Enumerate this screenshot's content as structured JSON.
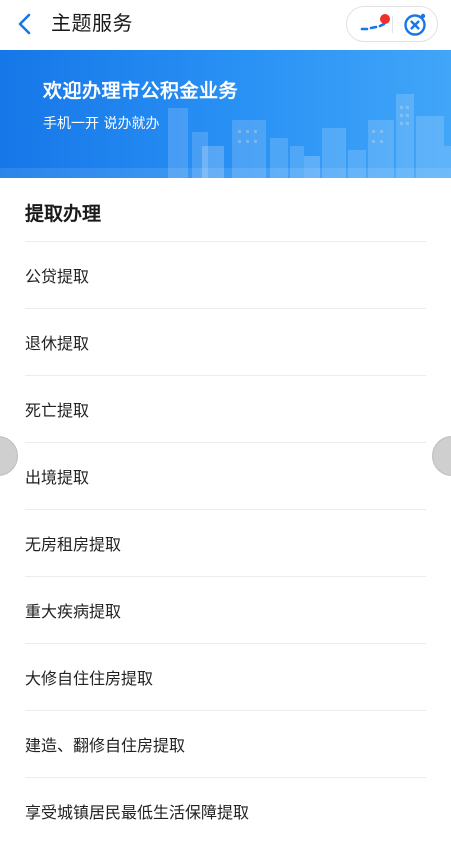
{
  "header": {
    "title": "主题服务",
    "back_icon": "chevron-left-icon",
    "more_icon": "more-dots-icon",
    "close_icon": "close-circle-icon",
    "accent_color": "#1677e8",
    "notification_dot_color": "#f0302a"
  },
  "banner": {
    "title": "欢迎办理市公积金业务",
    "subtitle": "手机一开 说办就办",
    "gradient_start": "#1677e8",
    "gradient_end": "#41a6f8"
  },
  "section": {
    "title": "提取办理",
    "items": [
      {
        "label": "公贷提取"
      },
      {
        "label": "退休提取"
      },
      {
        "label": "死亡提取"
      },
      {
        "label": "出境提取"
      },
      {
        "label": "无房租房提取"
      },
      {
        "label": "重大疾病提取"
      },
      {
        "label": "大修自住住房提取"
      },
      {
        "label": "建造、翻修自住房提取"
      },
      {
        "label": "享受城镇居民最低生活保障提取"
      }
    ]
  }
}
